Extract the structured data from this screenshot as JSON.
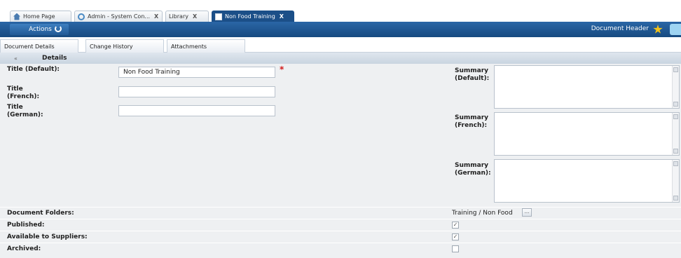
{
  "tabs": [
    {
      "label": "Home Page",
      "icon": "home-icon",
      "closable": false,
      "active": false
    },
    {
      "label": "Admin - System Con...",
      "icon": "settings-icon",
      "closable": true,
      "active": false
    },
    {
      "label": "Library",
      "icon": "",
      "closable": true,
      "active": false
    },
    {
      "label": "Non Food Training",
      "icon": "document-icon",
      "closable": true,
      "active": true
    }
  ],
  "close_glyph": "X",
  "toolbar": {
    "actions_label": "Actions",
    "document_header_label": "Document Header",
    "colors": {
      "bar": "#1b4f88",
      "star": "#f2c21a"
    }
  },
  "subtabs": [
    "Document Details",
    "Change History",
    "Attachments"
  ],
  "section": {
    "title": "Details",
    "collapse_glyph": "«"
  },
  "form": {
    "title_default_label": "Title (Default):",
    "title_default_value": "Non Food Training",
    "required_marker": "*",
    "title_french_label": "Title (French):",
    "title_french_value": "",
    "title_german_label": "Title (German):",
    "title_german_value": "",
    "summary_default_label": "Summary (Default):",
    "summary_french_label": "Summary (French):",
    "summary_german_label": "Summary (German):",
    "document_folders_label": "Document Folders:",
    "document_folders_value": "Training / Non Food",
    "browse_label": "...",
    "published_label": "Published:",
    "published_checked": true,
    "available_label": "Available to Suppliers:",
    "available_checked": true,
    "archived_label": "Archived:",
    "archived_checked": false,
    "check_glyph": "✓"
  }
}
